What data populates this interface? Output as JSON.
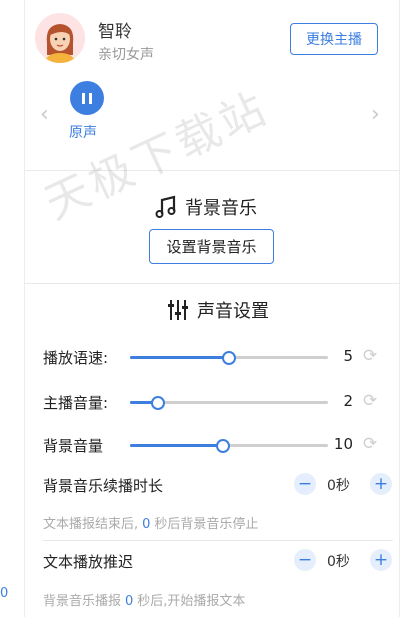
{
  "voice": {
    "name": "智聆",
    "description": "亲切女声",
    "change_label": "更换主播"
  },
  "carousel": {
    "item_label": "原声"
  },
  "background_music": {
    "title": "背景音乐",
    "button_label": "设置背景音乐"
  },
  "sound_settings": {
    "title": "声音设置",
    "sliders": [
      {
        "label": "播放语速:",
        "value": "5",
        "fill_fraction": 0.5
      },
      {
        "label": "主播音量:",
        "value": "2",
        "fill_fraction": 0.14
      },
      {
        "label": "背景音量",
        "value": "10",
        "fill_fraction": 0.47
      }
    ]
  },
  "bgm_duration": {
    "label": "背景音乐续播时长",
    "value": "0秒",
    "hint_prefix": "文本播报结束后,",
    "hint_num": "0",
    "hint_suffix": "秒后背景音乐停止"
  },
  "text_delay": {
    "label": "文本播放推迟",
    "value": "0秒",
    "hint_prefix": "背景音乐播报",
    "hint_num": "0",
    "hint_suffix": "秒后,开始播报文本"
  },
  "left_strip_text": "0",
  "watermark": "天极下载站",
  "colors": {
    "accent": "#3d7fe0",
    "track": "#cfcfcf",
    "hint": "#aaaaaa"
  }
}
